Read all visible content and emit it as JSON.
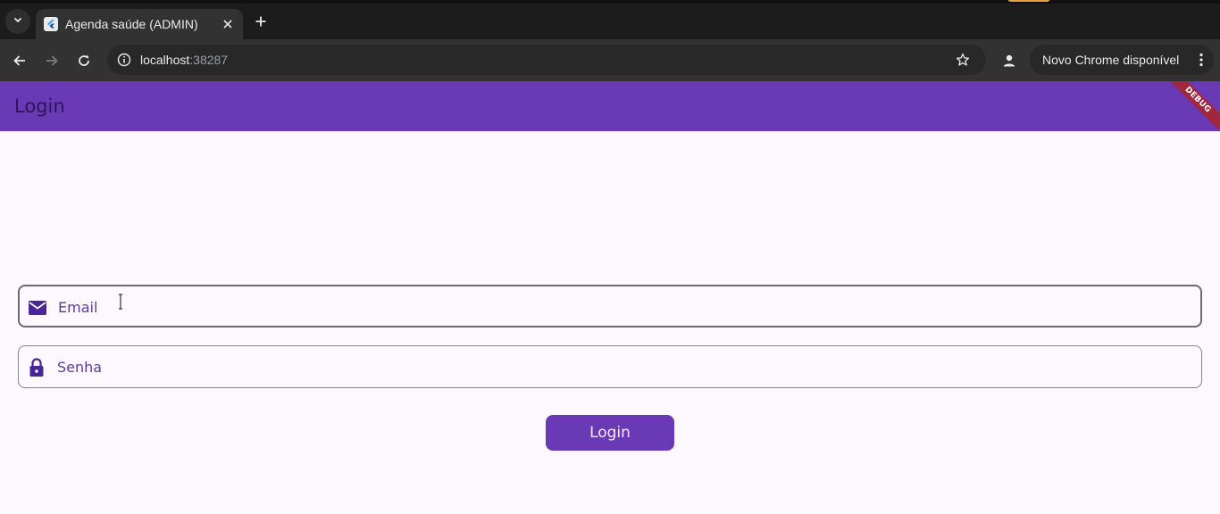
{
  "browser": {
    "tab_title": "Agenda saúde (ADMIN)",
    "url_host": "localhost",
    "url_port": ":38287",
    "update_label": "Novo Chrome disponível"
  },
  "appbar": {
    "title": "Login",
    "debug_label": "DEBUG"
  },
  "form": {
    "email_label": "Email",
    "password_label": "Senha",
    "login_button": "Login"
  },
  "colors": {
    "primary": "#6a3ab6",
    "background": "#fdf7fe",
    "icon": "#4a2596",
    "debug_banner": "#a0273f"
  },
  "icons": {
    "email": "envelope-icon",
    "password": "lock-icon"
  }
}
